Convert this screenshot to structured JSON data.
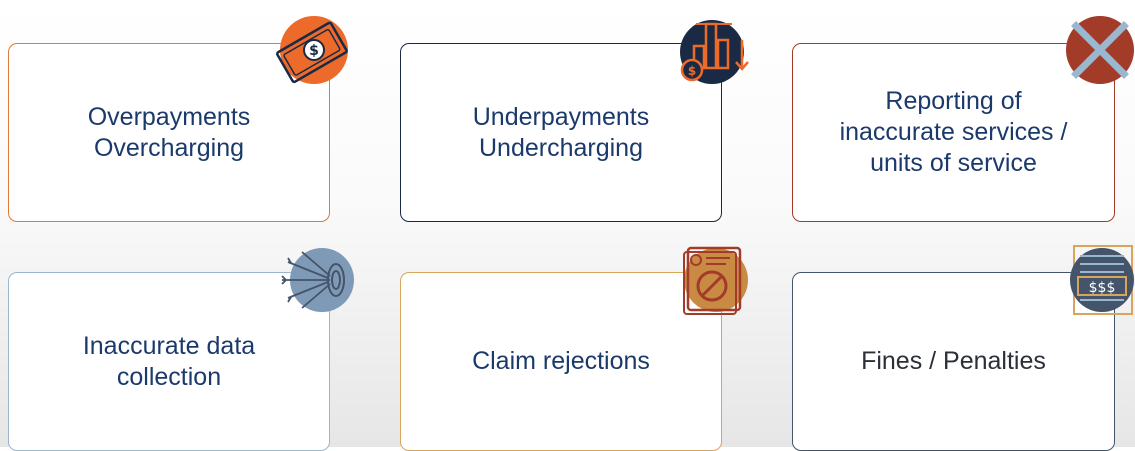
{
  "cards": [
    {
      "label": "Overpayments\nOvercharging",
      "border_color": "#e07b3c",
      "text_color": "#1b3a6b",
      "icon": "money-bill-icon",
      "icon_color": "#ec6a2a"
    },
    {
      "label": "Underpayments\nUndercharging",
      "border_color": "#1b2a44",
      "text_color": "#1b3a6b",
      "icon": "city-coins-icon",
      "icon_color": "#1b2a44"
    },
    {
      "label": "Reporting of\ninaccurate services /\nunits of service",
      "border_color": "#a33b29",
      "text_color": "#1b3a6b",
      "icon": "cross-mark-icon",
      "icon_color": "#a33b29"
    },
    {
      "label": "Inaccurate data\ncollection",
      "border_color": "#9bb6cf",
      "text_color": "#1b3a6b",
      "icon": "target-arrows-icon",
      "icon_color": "#7f9ab7"
    },
    {
      "label": "Claim rejections",
      "border_color": "#d9a55c",
      "text_color": "#1b3a6b",
      "icon": "rejected-document-icon",
      "icon_color": "#c98a44"
    },
    {
      "label": "Fines / Penalties",
      "border_color": "#44546a",
      "text_color": "#2a2f38",
      "icon": "invoice-dollar-icon",
      "icon_color": "#44546a"
    }
  ]
}
